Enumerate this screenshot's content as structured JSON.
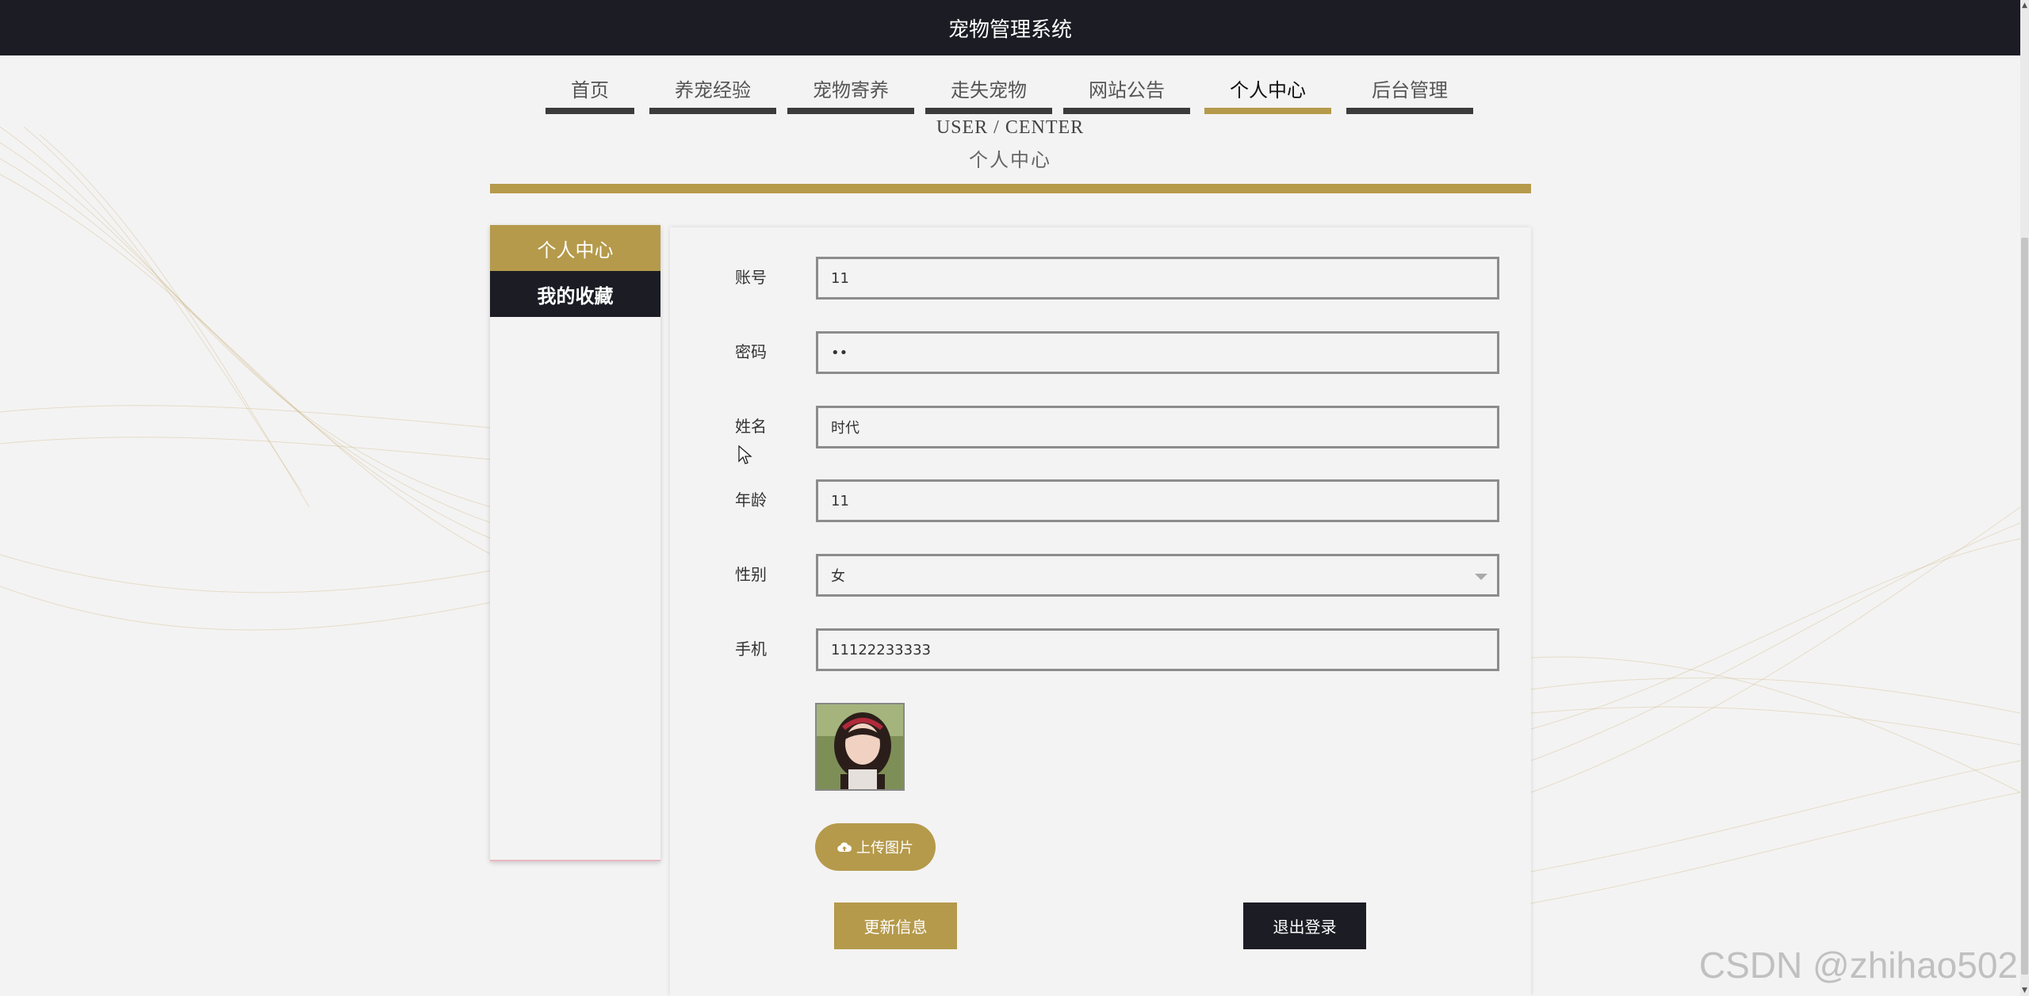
{
  "app": {
    "title": "宠物管理系统"
  },
  "nav": {
    "items": [
      {
        "label": "首页",
        "active": false
      },
      {
        "label": "养宠经验",
        "active": false
      },
      {
        "label": "宠物寄养",
        "active": false
      },
      {
        "label": "走失宠物",
        "active": false
      },
      {
        "label": "网站公告",
        "active": false
      },
      {
        "label": "个人中心",
        "active": true
      },
      {
        "label": "后台管理",
        "active": false
      }
    ]
  },
  "heading": {
    "en": "USER / CENTER",
    "cn": "个人中心"
  },
  "side_menu": {
    "items": [
      {
        "label": "个人中心",
        "active": true
      },
      {
        "label": "我的收藏",
        "active": false
      }
    ]
  },
  "form": {
    "account": {
      "label": "账号",
      "value": "11"
    },
    "password": {
      "label": "密码",
      "value": "••"
    },
    "name": {
      "label": "姓名",
      "value": "时代"
    },
    "age": {
      "label": "年龄",
      "value": "11"
    },
    "gender": {
      "label": "性别",
      "value": "女"
    },
    "phone": {
      "label": "手机",
      "value": "11122233333"
    },
    "upload_label": "上传图片",
    "update_label": "更新信息",
    "logout_label": "退出登录"
  },
  "colors": {
    "accent": "#b59a4b",
    "dark": "#1b1c24",
    "background": "#f4f3f3"
  },
  "watermark": "CSDN @zhihao502"
}
